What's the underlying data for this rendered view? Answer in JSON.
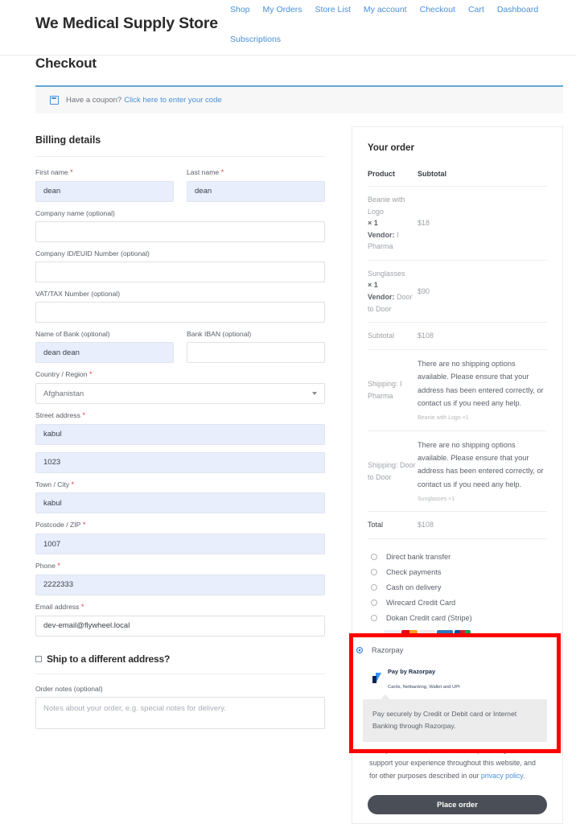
{
  "header": {
    "site_title": "We Medical Supply Store",
    "nav_row1": [
      {
        "label": "Shop"
      },
      {
        "label": "My Orders"
      },
      {
        "label": "Store List"
      },
      {
        "label": "My account"
      },
      {
        "label": "Checkout"
      },
      {
        "label": "Cart"
      },
      {
        "label": "Dashboard"
      }
    ],
    "nav_row2": [
      {
        "label": "Subscriptions"
      }
    ]
  },
  "page_title": "Checkout",
  "coupon": {
    "icon": "coupon-tag-icon",
    "text": "Have a coupon?",
    "link": "Click here to enter your code"
  },
  "billing": {
    "heading": "Billing details",
    "first_name": {
      "label": "First name",
      "required": true,
      "value": "dean"
    },
    "last_name": {
      "label": "Last name",
      "required": true,
      "value": "dean"
    },
    "company_name": {
      "label": "Company name (optional)",
      "value": ""
    },
    "company_id": {
      "label": "Company ID/EUID Number (optional)",
      "value": ""
    },
    "vat_tax": {
      "label": "VAT/TAX Number (optional)",
      "value": ""
    },
    "bank_name": {
      "label": "Name of Bank (optional)",
      "value": "dean dean"
    },
    "bank_iban": {
      "label": "Bank IBAN (optional)",
      "value": ""
    },
    "country": {
      "label": "Country / Region",
      "required": true,
      "value": "Afghanistan"
    },
    "street_address": {
      "label": "Street address",
      "required": true,
      "value": "kabul"
    },
    "street_address_2": {
      "value": "1023"
    },
    "city": {
      "label": "Town / City",
      "required": true,
      "value": "kabul"
    },
    "postcode": {
      "label": "Postcode / ZIP",
      "required": true,
      "value": "1007"
    },
    "phone": {
      "label": "Phone",
      "required": true,
      "value": "2222333"
    },
    "email": {
      "label": "Email address",
      "required": true,
      "value": "dev-email@flywheel.local"
    },
    "ship_different": {
      "label": "Ship to a different address?",
      "checked": false
    },
    "order_notes": {
      "label": "Order notes (optional)",
      "value": "",
      "placeholder": "Notes about your order, e.g. special notes for delivery."
    }
  },
  "order": {
    "heading": "Your order",
    "col_product": "Product",
    "col_subtotal": "Subtotal",
    "items": [
      {
        "name": "Beanie with Logo",
        "qty": "× 1",
        "vendor_label": "Vendor:",
        "vendor": "I Pharma",
        "subtotal": "$18"
      },
      {
        "name": "Sunglasses",
        "qty": "× 1",
        "vendor_label": "Vendor:",
        "vendor": "Door to Door",
        "subtotal": "$90"
      }
    ],
    "subtotal_label": "Subtotal",
    "subtotal_value": "$108",
    "shipping_rows": [
      {
        "label": "Shipping: I Pharma",
        "message": "There are no shipping options available. Please ensure that your address has been entered correctly, or contact us if you need any help.",
        "sub": "Beanie with Logo ×1"
      },
      {
        "label": "Shipping: Door to Door",
        "message": "There are no shipping options available. Please ensure that your address has been entered correctly, or contact us if you need any help.",
        "sub": "Sunglasses ×1"
      }
    ],
    "total_label": "Total",
    "total_value": "$108"
  },
  "payment": {
    "options": [
      {
        "label": "Direct bank transfer",
        "selected": false
      },
      {
        "label": "Check payments",
        "selected": false
      },
      {
        "label": "Cash on delivery",
        "selected": false
      },
      {
        "label": "Wirecard Credit Card",
        "selected": false
      },
      {
        "label": "Dokan Credit card (Stripe)",
        "selected": false
      }
    ],
    "card_icons": [
      {
        "name": "visa-icon",
        "text": "VISA"
      },
      {
        "name": "mastercard-icon",
        "text": ""
      },
      {
        "name": "discover-icon",
        "text": "DISC"
      },
      {
        "name": "amex-icon",
        "text": "AMEX"
      },
      {
        "name": "jcb-icon",
        "text": ""
      }
    ],
    "razorpay": {
      "label": "Razorpay",
      "selected": true,
      "logo_title": "Pay by Razorpay",
      "logo_subtitle": "Cards, Netbanking, Wallet and UPI",
      "description": "Pay securely by Credit or Debit card or Internet Banking through Razorpay."
    },
    "highlight_color": "#ff0000"
  },
  "footer": {
    "privacy_text": "Your personal data will be used to process your order, support your experience throughout this website, and for other purposes described in our ",
    "privacy_link": "privacy policy",
    "privacy_suffix": ".",
    "place_order": "Place order"
  }
}
